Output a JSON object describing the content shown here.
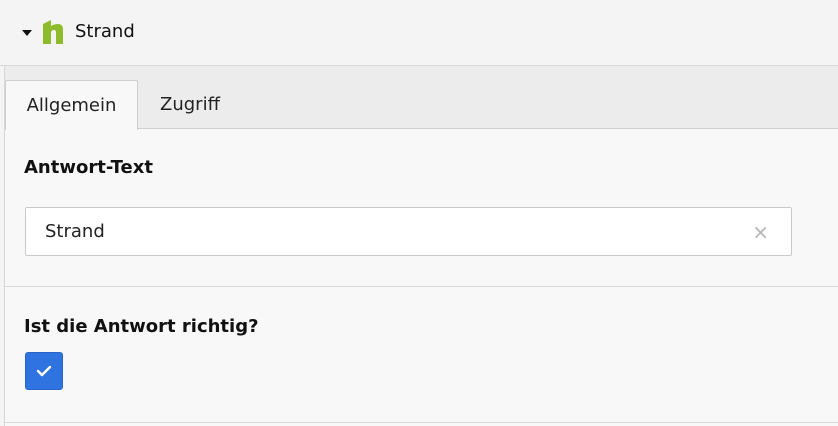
{
  "header": {
    "title": "Strand",
    "caret_icon": "caret-down-icon",
    "logo_icon": "app-logo-icon",
    "logo_color": "#8dbb2b"
  },
  "tabs": [
    {
      "label": "Allgemein",
      "active": true
    },
    {
      "label": "Zugriff",
      "active": false
    }
  ],
  "answer_text": {
    "label": "Antwort-Text",
    "value": "Strand",
    "clear_symbol": "×"
  },
  "is_correct": {
    "label": "Ist die Antwort richtig?",
    "checked": true,
    "check_color": "#2f73e0"
  }
}
